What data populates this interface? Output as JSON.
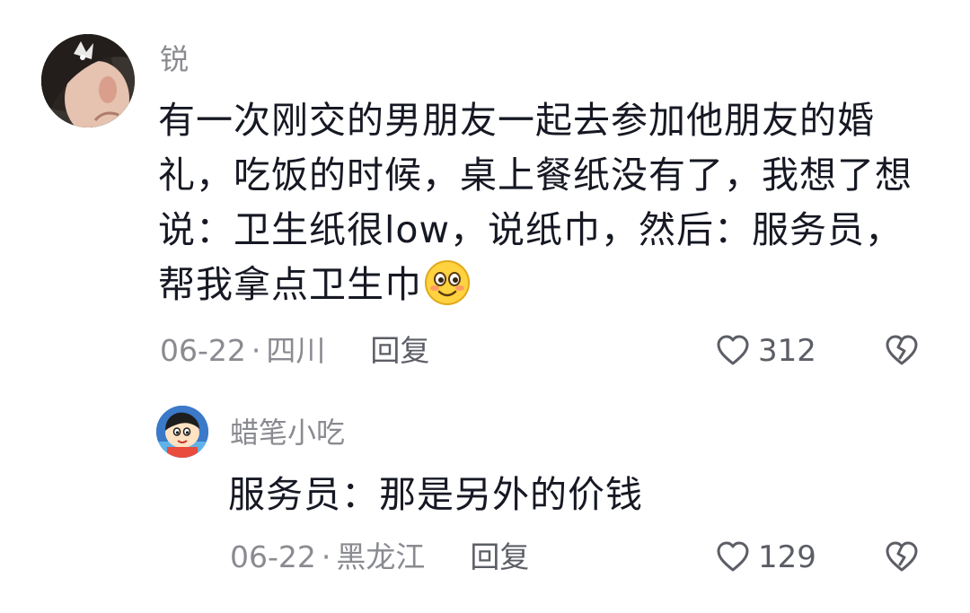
{
  "comment": {
    "username": "锐",
    "content": "有一次刚交的男朋友一起去参加他朋友的婚礼，吃饭的时候，桌上餐纸没有了，我想了想说：卫生纸很low，说纸巾，然后：服务员，帮我拿点卫生巾",
    "date": "06-22",
    "separator": "·",
    "location": "四川",
    "reply_label": "回复",
    "like_count": "312",
    "avatar_icon": "user-avatar-girl",
    "emoji_icon": "shy-smile-emoji"
  },
  "reply": {
    "username": "蜡笔小吃",
    "content": "服务员：那是另外的价钱",
    "date": "06-22",
    "separator": "·",
    "location": "黑龙江",
    "reply_label": "回复",
    "like_count": "129",
    "avatar_icon": "user-avatar-cartoon"
  },
  "colors": {
    "text_primary": "#161823",
    "text_secondary": "#8a8b91",
    "text_action": "#5c5e66",
    "icon_stroke": "#5c5e66",
    "emoji_yellow": "#ffd23f"
  }
}
